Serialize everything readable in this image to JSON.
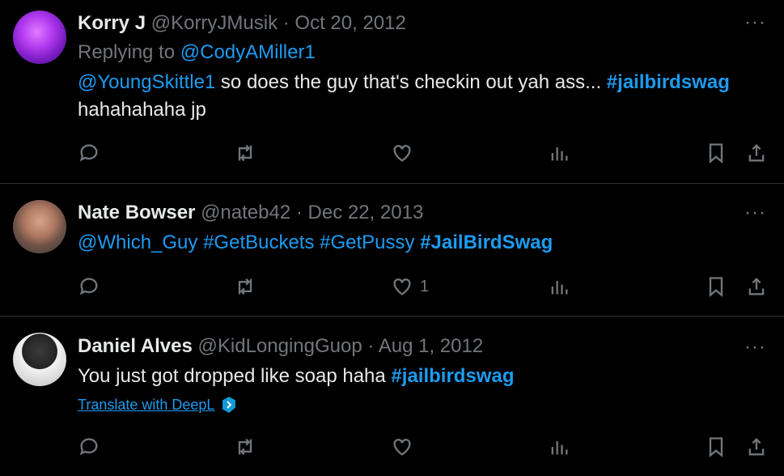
{
  "tweets": [
    {
      "name": "Korry J",
      "handle": "@KorryJMusik",
      "sep": " · ",
      "date": "Oct 20, 2012",
      "replying_prefix": "Replying to ",
      "replying_to": "@CodyAMiller1",
      "mention": "@YoungSkittle1",
      "text1": " so does the guy that's checkin out yah ass... ",
      "hashtag": "#jailbirdswag",
      "text2": "hahahahaha jp",
      "like_count": ""
    },
    {
      "name": "Nate Bowser",
      "handle": "@nateb42",
      "sep": " · ",
      "date": "Dec 22, 2013",
      "tags_plain": "@Which_Guy #GetBuckets #GetPussy ",
      "hashtag": "#JailBirdSwag",
      "like_count": "1"
    },
    {
      "name": "Daniel Alves",
      "handle": "@KidLongingGuop",
      "sep": " · ",
      "date": "Aug 1, 2012",
      "text1": "You just got dropped like soap haha ",
      "hashtag": "#jailbirdswag",
      "translate": "Translate with DeepL",
      "like_count": ""
    }
  ],
  "more_label": "···",
  "colors": {
    "accent": "#1d9bf0",
    "muted": "#71767b",
    "text": "#e7e9ea",
    "bg": "#000000"
  },
  "icons": [
    "reply-icon",
    "retweet-icon",
    "like-icon",
    "views-icon",
    "bookmark-icon",
    "share-icon",
    "more-icon",
    "deepl-icon"
  ]
}
